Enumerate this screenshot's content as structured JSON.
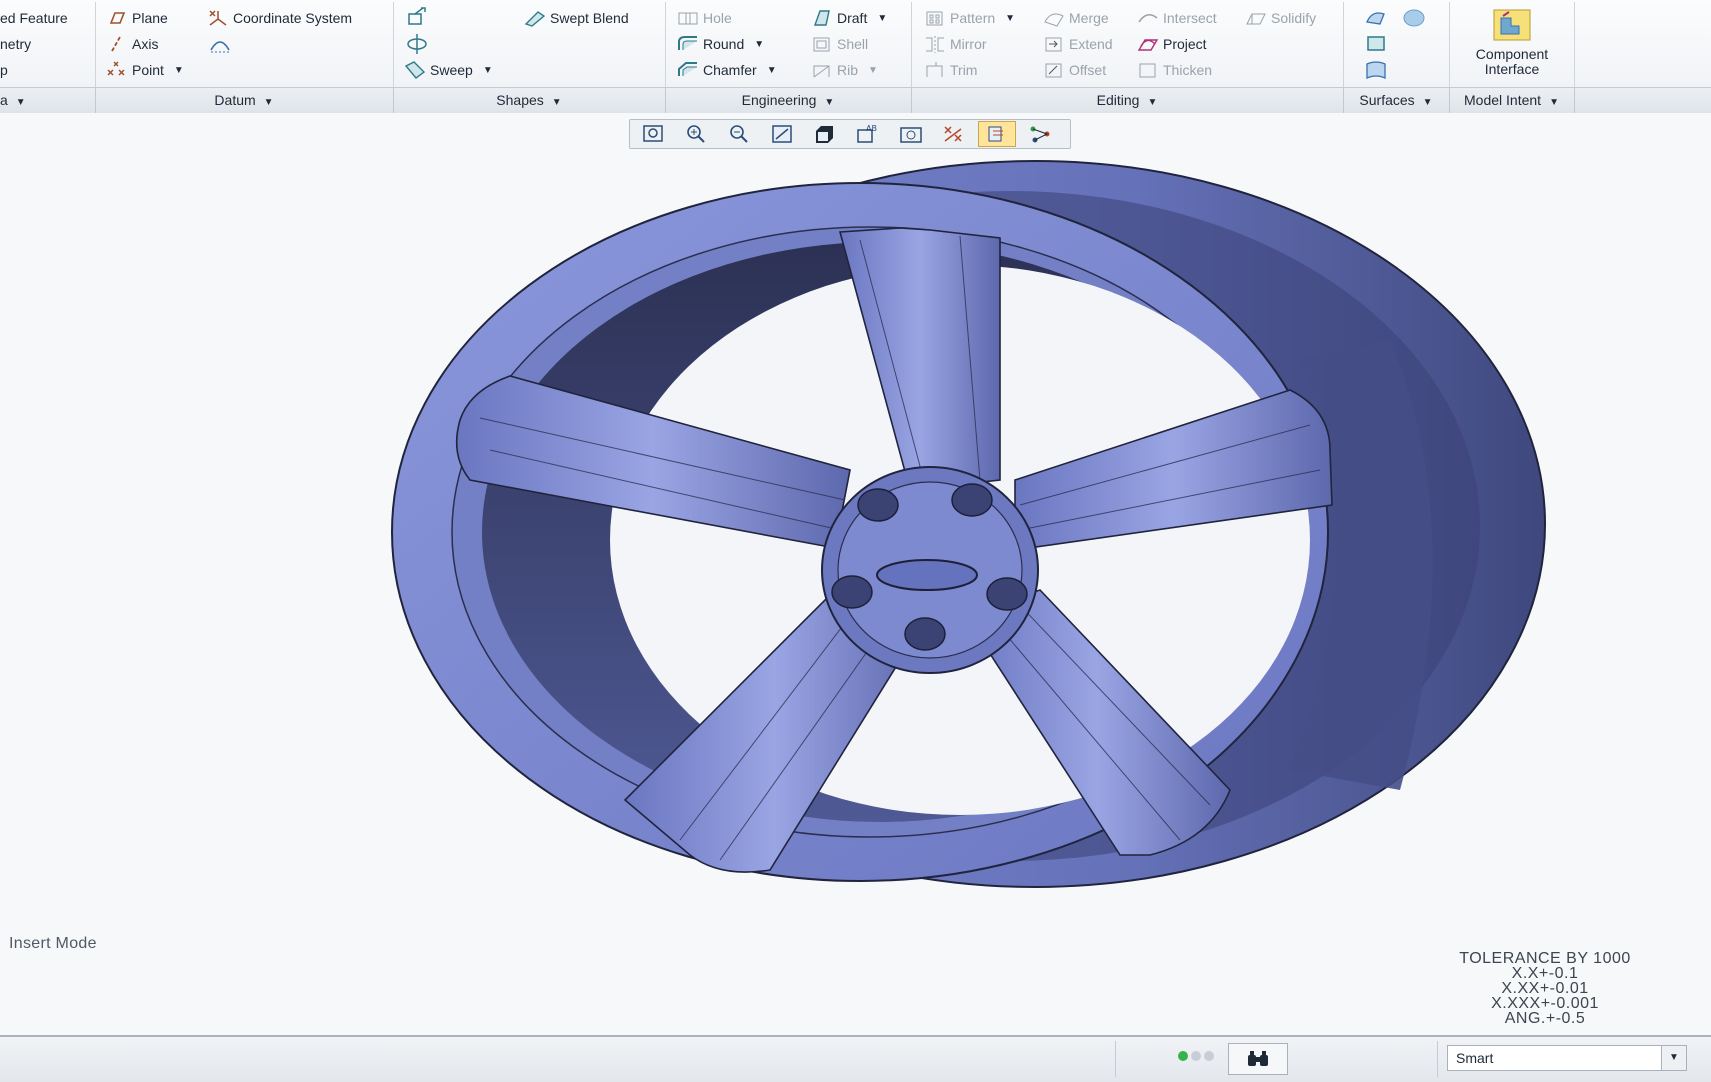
{
  "ribbon": {
    "model": {
      "row1": "ed Feature",
      "row2": "netry",
      "row3": "p",
      "group": "a"
    },
    "datum": {
      "plane": "Plane",
      "axis": "Axis",
      "point": "Point",
      "coord_sys": "Coordinate System",
      "group": "Datum"
    },
    "shapes": {
      "swept_blend": "Swept Blend",
      "sweep": "Sweep",
      "group": "Shapes"
    },
    "engineering": {
      "hole": "Hole",
      "round": "Round",
      "chamfer": "Chamfer",
      "draft": "Draft",
      "shell": "Shell",
      "rib": "Rib",
      "group": "Engineering"
    },
    "editing": {
      "pattern": "Pattern",
      "mirror": "Mirror",
      "trim": "Trim",
      "merge": "Merge",
      "extend": "Extend",
      "offset": "Offset",
      "intersect": "Intersect",
      "project": "Project",
      "thicken": "Thicken",
      "solidify": "Solidify",
      "group": "Editing"
    },
    "surfaces": {
      "group": "Surfaces"
    },
    "model_intent": {
      "component_interface_1": "Component",
      "component_interface_2": "Interface",
      "group": "Model Intent"
    }
  },
  "graphics_toolbar": {
    "buttons": [
      "refit-icon",
      "zoom-in-icon",
      "zoom-out-icon",
      "repaint-icon",
      "display-style-icon",
      "saved-orientations-icon",
      "view-manager-icon",
      "datum-display-icon",
      "spin-center-icon",
      "annotation-display-icon"
    ]
  },
  "viewport": {
    "mode_text": "Insert Mode",
    "tolerance": {
      "header": "TOLERANCE BY 1000",
      "l1": "X.X+-0.1",
      "l2": "X.XX+-0.01",
      "l3": "X.XXX+-0.001",
      "l4": "ANG.+-0.5"
    },
    "model_color": "#6f7cc6"
  },
  "status": {
    "filter_value": "Smart"
  }
}
